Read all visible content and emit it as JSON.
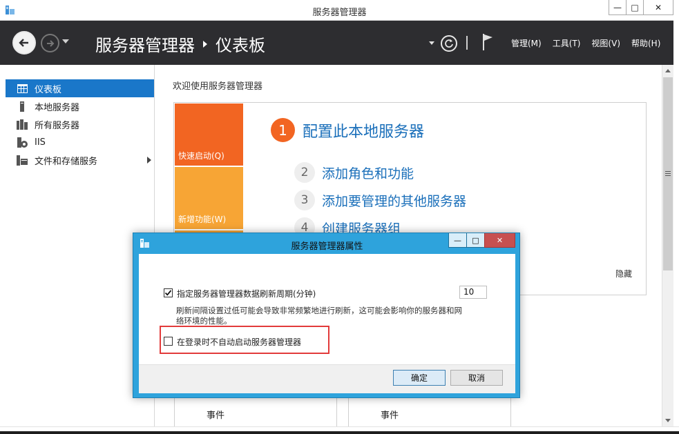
{
  "window": {
    "title": "服务器管理器",
    "controls": {
      "minimize": "—",
      "maximize": "□",
      "close": "✕"
    }
  },
  "header": {
    "breadcrumb_root": "服务器管理器",
    "breadcrumb_current": "仪表板",
    "menus": [
      "管理(M)",
      "工具(T)",
      "视图(V)",
      "帮助(H)"
    ]
  },
  "sidebar": {
    "items": [
      {
        "label": "仪表板",
        "icon": "dashboard-icon",
        "active": true
      },
      {
        "label": "本地服务器",
        "icon": "local-server-icon"
      },
      {
        "label": "所有服务器",
        "icon": "all-servers-icon"
      },
      {
        "label": "IIS",
        "icon": "iis-icon"
      },
      {
        "label": "文件和存储服务",
        "icon": "file-storage-icon",
        "has_children": true
      }
    ]
  },
  "main": {
    "welcome": "欢迎使用服务器管理器",
    "tiles": {
      "quick_start": "快速启动(Q)",
      "new_features": "新增功能(W)"
    },
    "steps": [
      {
        "num": "1",
        "label": "配置此本地服务器"
      },
      {
        "num": "2",
        "label": "添加角色和功能"
      },
      {
        "num": "3",
        "label": "添加要管理的其他服务器"
      },
      {
        "num": "4",
        "label": "创建服务器组"
      }
    ],
    "hide": "隐藏",
    "events": [
      "事件",
      "事件"
    ]
  },
  "dialog": {
    "title": "服务器管理器属性",
    "refresh_label": "指定服务器管理器数据刷新周期(分钟)",
    "refresh_checked": true,
    "refresh_value": "10",
    "note": "刷新间隔设置过低可能会导致非常频繁地进行刷新，这可能会影响你的服务器和网络环境的性能。",
    "autostart_label": "在登录时不自动启动服务器管理器",
    "autostart_checked": false,
    "ok": "确定",
    "cancel": "取消"
  },
  "colors": {
    "accent_blue": "#1a77c9",
    "header_dark": "#2d2d30",
    "tile_orange": "#f26522",
    "tile_amber": "#f7a535",
    "dialog_frame": "#2ea3dc",
    "highlight_red": "#e23a3a"
  }
}
